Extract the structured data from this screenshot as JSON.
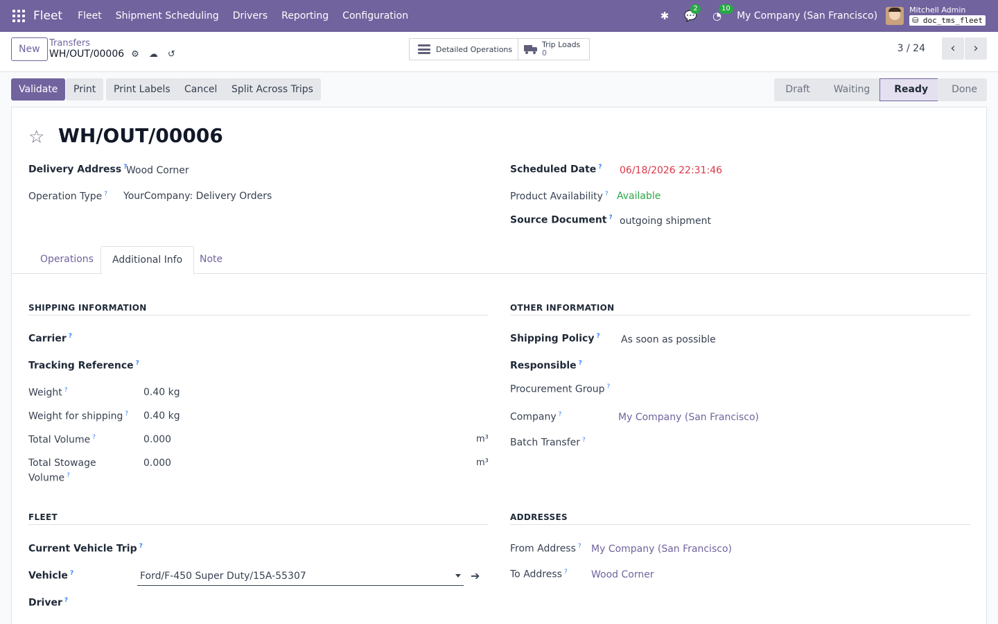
{
  "navbar": {
    "brand": "Fleet",
    "menu": [
      "Fleet",
      "Shipment Scheduling",
      "Drivers",
      "Reporting",
      "Configuration"
    ],
    "messages_badge": "2",
    "activities_badge": "10",
    "company": "My Company (San Francisco)",
    "user": "Mitchell Admin",
    "database": "doc_tms_fleet"
  },
  "control": {
    "new_label": "New",
    "breadcrumb": "Transfers",
    "record": "WH/OUT/00006",
    "detailed_operations": "Detailed Operations",
    "trip_loads_label": "Trip Loads",
    "trip_loads_value": "0",
    "pager": "3 / 24"
  },
  "actions": {
    "validate": "Validate",
    "print": "Print",
    "print_labels": "Print Labels",
    "cancel": "Cancel",
    "split": "Split Across Trips"
  },
  "status": {
    "stages": [
      "Draft",
      "Waiting",
      "Ready",
      "Done"
    ],
    "active": "Ready"
  },
  "form": {
    "title": "WH/OUT/00006",
    "delivery_address_label": "Delivery Address",
    "delivery_address": "Wood Corner",
    "operation_type_label": "Operation Type",
    "operation_type": "YourCompany: Delivery Orders",
    "scheduled_date_label": "Scheduled Date",
    "scheduled_date": "06/18/2026 22:31:46",
    "availability_label": "Product Availability",
    "availability": "Available",
    "source_label": "Source Document",
    "source": "outgoing shipment"
  },
  "tabs": [
    "Operations",
    "Additional Info",
    "Note"
  ],
  "shipping": {
    "title": "SHIPPING INFORMATION",
    "carrier_label": "Carrier",
    "tracking_label": "Tracking Reference",
    "weight_label": "Weight",
    "weight": "0.40",
    "weight_unit": "kg",
    "weight_shipping_label": "Weight for shipping",
    "weight_shipping": "0.40",
    "weight_shipping_unit": "kg",
    "volume_label": "Total Volume",
    "volume": "0.000",
    "volume_unit": "m³",
    "stowage_label_1": "Total Stowage",
    "stowage_label_2": "Volume",
    "stowage": "0.000",
    "stowage_unit": "m³"
  },
  "other": {
    "title": "OTHER INFORMATION",
    "policy_label": "Shipping Policy",
    "policy": "As soon as possible",
    "responsible_label": "Responsible",
    "procurement_label": "Procurement Group",
    "company_label": "Company",
    "company": "My Company (San Francisco)",
    "batch_label": "Batch Transfer"
  },
  "fleet": {
    "title": "FLEET",
    "trip_label": "Current Vehicle Trip",
    "vehicle_label": "Vehicle",
    "vehicle": "Ford/F-450 Super Duty/15A-55307",
    "driver_label": "Driver"
  },
  "addresses": {
    "title": "ADDRESSES",
    "from_label": "From Address",
    "from": "My Company (San Francisco)",
    "to_label": "To Address",
    "to": "Wood Corner"
  },
  "colors": {
    "brand": "#71639e",
    "deadline": "#dc3545",
    "available": "#28a745"
  }
}
